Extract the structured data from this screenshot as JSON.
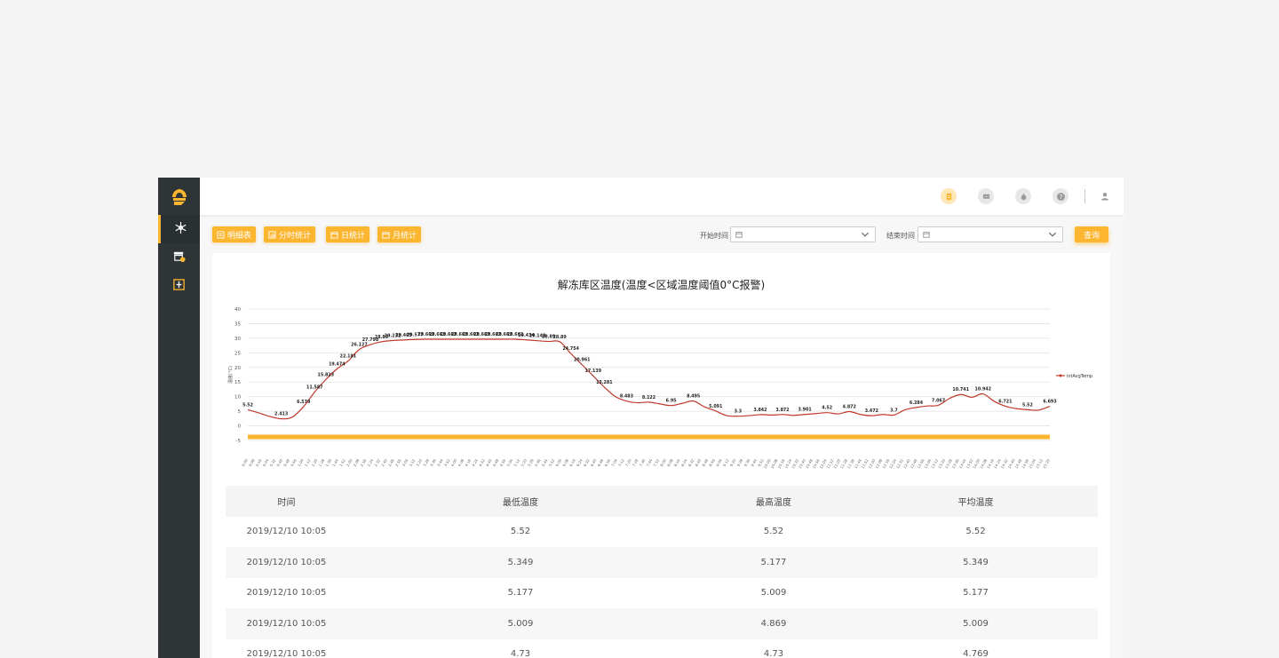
{
  "sidebar": {
    "items": [
      {
        "icon": "snowflake-icon"
      },
      {
        "icon": "store-warning-icon"
      },
      {
        "icon": "thermometer-box-icon"
      }
    ]
  },
  "header": {
    "icons": [
      "report-icon",
      "message-icon",
      "money-bag-icon",
      "help-icon",
      "user-icon"
    ]
  },
  "toolbar": {
    "detail_label": "明细表",
    "hourly_label": "分时统计",
    "daily_label": "日统计",
    "monthly_label": "月统计",
    "start_label": "开始时间",
    "end_label": "结束时间",
    "query_label": "查询"
  },
  "colors": {
    "accent": "#fbb52f",
    "sidebar": "#2f3437",
    "line": "#c0392b"
  },
  "chart_data": {
    "type": "line",
    "title": "解冻库区温度(温度<区域温度阈值0°C报警)",
    "ylabel": "温度(°C)",
    "ylim": [
      -5,
      40
    ],
    "yticks": [
      -5,
      0,
      5,
      10,
      15,
      20,
      25,
      30,
      35,
      40
    ],
    "legend": "right",
    "threshold": 0,
    "series": [
      {
        "name": "intAvgTemp",
        "values": [
          5.52,
          4.4,
          3.2,
          2.413,
          3.0,
          6.579,
          11.587,
          15.823,
          19.474,
          22.181,
          26.127,
          27.798,
          28.8,
          29.232,
          29.405,
          29.577,
          29.662,
          29.662,
          29.662,
          29.662,
          29.662,
          29.662,
          29.662,
          29.662,
          29.662,
          29.434,
          29.148,
          28.89,
          28.8,
          24.754,
          20.961,
          17.139,
          13.281,
          10.0,
          8.483,
          7.9,
          8.122,
          7.5,
          6.95,
          7.7,
          8.495,
          6.5,
          5.091,
          3.5,
          3.3,
          3.5,
          3.842,
          3.7,
          3.872,
          3.6,
          3.901,
          4.2,
          4.52,
          4.1,
          4.872,
          3.9,
          3.472,
          3.9,
          3.7,
          5.5,
          6.284,
          6.8,
          7.067,
          9.4,
          10.741,
          9.8,
          10.942,
          8.4,
          6.721,
          5.9,
          5.52,
          5.4,
          6.693
        ]
      }
    ],
    "labels": [
      {
        "i": 0,
        "t": "5.52"
      },
      {
        "i": 3,
        "t": "2.413"
      },
      {
        "i": 5,
        "t": "6.579"
      },
      {
        "i": 6,
        "t": "11.587"
      },
      {
        "i": 7,
        "t": "15.823"
      },
      {
        "i": 8,
        "t": "19.474"
      },
      {
        "i": 9,
        "t": "22.181"
      },
      {
        "i": 10,
        "t": "26.127"
      },
      {
        "i": 11,
        "t": "27.798"
      },
      {
        "i": 12,
        "t": "28.89"
      },
      {
        "i": 13,
        "t": "29.232"
      },
      {
        "i": 14,
        "t": "29.405"
      },
      {
        "i": 15,
        "t": "29.577"
      },
      {
        "i": 16,
        "t": "29.662"
      },
      {
        "i": 17,
        "t": "29.662"
      },
      {
        "i": 18,
        "t": "29.662"
      },
      {
        "i": 19,
        "t": "29.662"
      },
      {
        "i": 20,
        "t": "29.662"
      },
      {
        "i": 21,
        "t": "29.662"
      },
      {
        "i": 22,
        "t": "29.662"
      },
      {
        "i": 23,
        "t": "29.662"
      },
      {
        "i": 24,
        "t": "29.662"
      },
      {
        "i": 25,
        "t": "29.434"
      },
      {
        "i": 26,
        "t": "29.148"
      },
      {
        "i": 27,
        "t": "28.89"
      },
      {
        "i": 28,
        "t": "28.89"
      },
      {
        "i": 29,
        "t": "24.754"
      },
      {
        "i": 30,
        "t": "20.961"
      },
      {
        "i": 31,
        "t": "17.139"
      },
      {
        "i": 32,
        "t": "13.281"
      },
      {
        "i": 34,
        "t": "8.483"
      },
      {
        "i": 36,
        "t": "8.122"
      },
      {
        "i": 38,
        "t": "6.95"
      },
      {
        "i": 40,
        "t": "8.495"
      },
      {
        "i": 42,
        "t": "5.091"
      },
      {
        "i": 44,
        "t": "3.3"
      },
      {
        "i": 46,
        "t": "3.842"
      },
      {
        "i": 48,
        "t": "3.872"
      },
      {
        "i": 50,
        "t": "3.901"
      },
      {
        "i": 52,
        "t": "4.52"
      },
      {
        "i": 54,
        "t": "4.872"
      },
      {
        "i": 56,
        "t": "3.472"
      },
      {
        "i": 58,
        "t": "3.7"
      },
      {
        "i": 60,
        "t": "6.284"
      },
      {
        "i": 62,
        "t": "7.067"
      },
      {
        "i": 64,
        "t": "10.741"
      },
      {
        "i": 66,
        "t": "10.942"
      },
      {
        "i": 68,
        "t": "6.721"
      },
      {
        "i": 70,
        "t": "5.52"
      },
      {
        "i": 72,
        "t": "6.693"
      }
    ],
    "xticks": [
      "0:00",
      "0:08",
      "0:16",
      "0:24",
      "0:32",
      "0:40",
      "0:48",
      "0:56",
      "1:04",
      "1:12",
      "1:20",
      "1:28",
      "1:36",
      "1:44",
      "1:52",
      "2:00",
      "2:08",
      "2:16",
      "2:24",
      "2:32",
      "2:40",
      "2:48",
      "2:56",
      "3:04",
      "3:12",
      "3:20",
      "3:28",
      "3:36",
      "3:44",
      "3:52",
      "4:00",
      "4:08",
      "4:16",
      "4:24",
      "4:32",
      "4:40",
      "4:48",
      "4:56",
      "5:04",
      "5:12",
      "5:20",
      "5:28",
      "5:36",
      "5:44",
      "5:52",
      "6:00",
      "6:08",
      "6:16",
      "6:24",
      "6:32",
      "6:40",
      "6:48",
      "6:56",
      "7:04",
      "7:12",
      "7:20",
      "7:28",
      "7:36",
      "7:44",
      "7:52",
      "8:00",
      "8:08",
      "8:16",
      "8:24",
      "8:32",
      "8:40",
      "8:48",
      "8:56",
      "9:04",
      "9:12",
      "9:20",
      "9:28",
      "9:36",
      "9:44",
      "9:52",
      "10:00",
      "10:08",
      "10:16",
      "10:24",
      "10:32",
      "10:40",
      "10:48",
      "10:56",
      "11:04",
      "11:12",
      "11:20",
      "11:28",
      "11:36",
      "11:44",
      "11:52",
      "12:00",
      "12:08",
      "12:16",
      "12:24",
      "12:32",
      "12:40",
      "12:48",
      "12:56",
      "13:04",
      "13:12",
      "13:20",
      "13:28",
      "13:36",
      "13:44",
      "13:52",
      "14:00",
      "14:08",
      "14:16",
      "14:24",
      "14:32",
      "14:40",
      "14:48",
      "14:56",
      "15:04",
      "15:12",
      "15:20"
    ]
  },
  "table": {
    "headers": [
      "时间",
      "最低温度",
      "最高温度",
      "平均温度"
    ],
    "rows": [
      [
        "2019/12/10 10:05",
        "5.52",
        "5.52",
        "5.52"
      ],
      [
        "2019/12/10 10:05",
        "5.349",
        "5.177",
        "5.349"
      ],
      [
        "2019/12/10 10:05",
        "5.177",
        "5.009",
        "5.177"
      ],
      [
        "2019/12/10 10:05",
        "5.009",
        "4.869",
        "5.009"
      ],
      [
        "2019/12/10 10:05",
        "4.73",
        "4.73",
        "4.769"
      ]
    ]
  }
}
